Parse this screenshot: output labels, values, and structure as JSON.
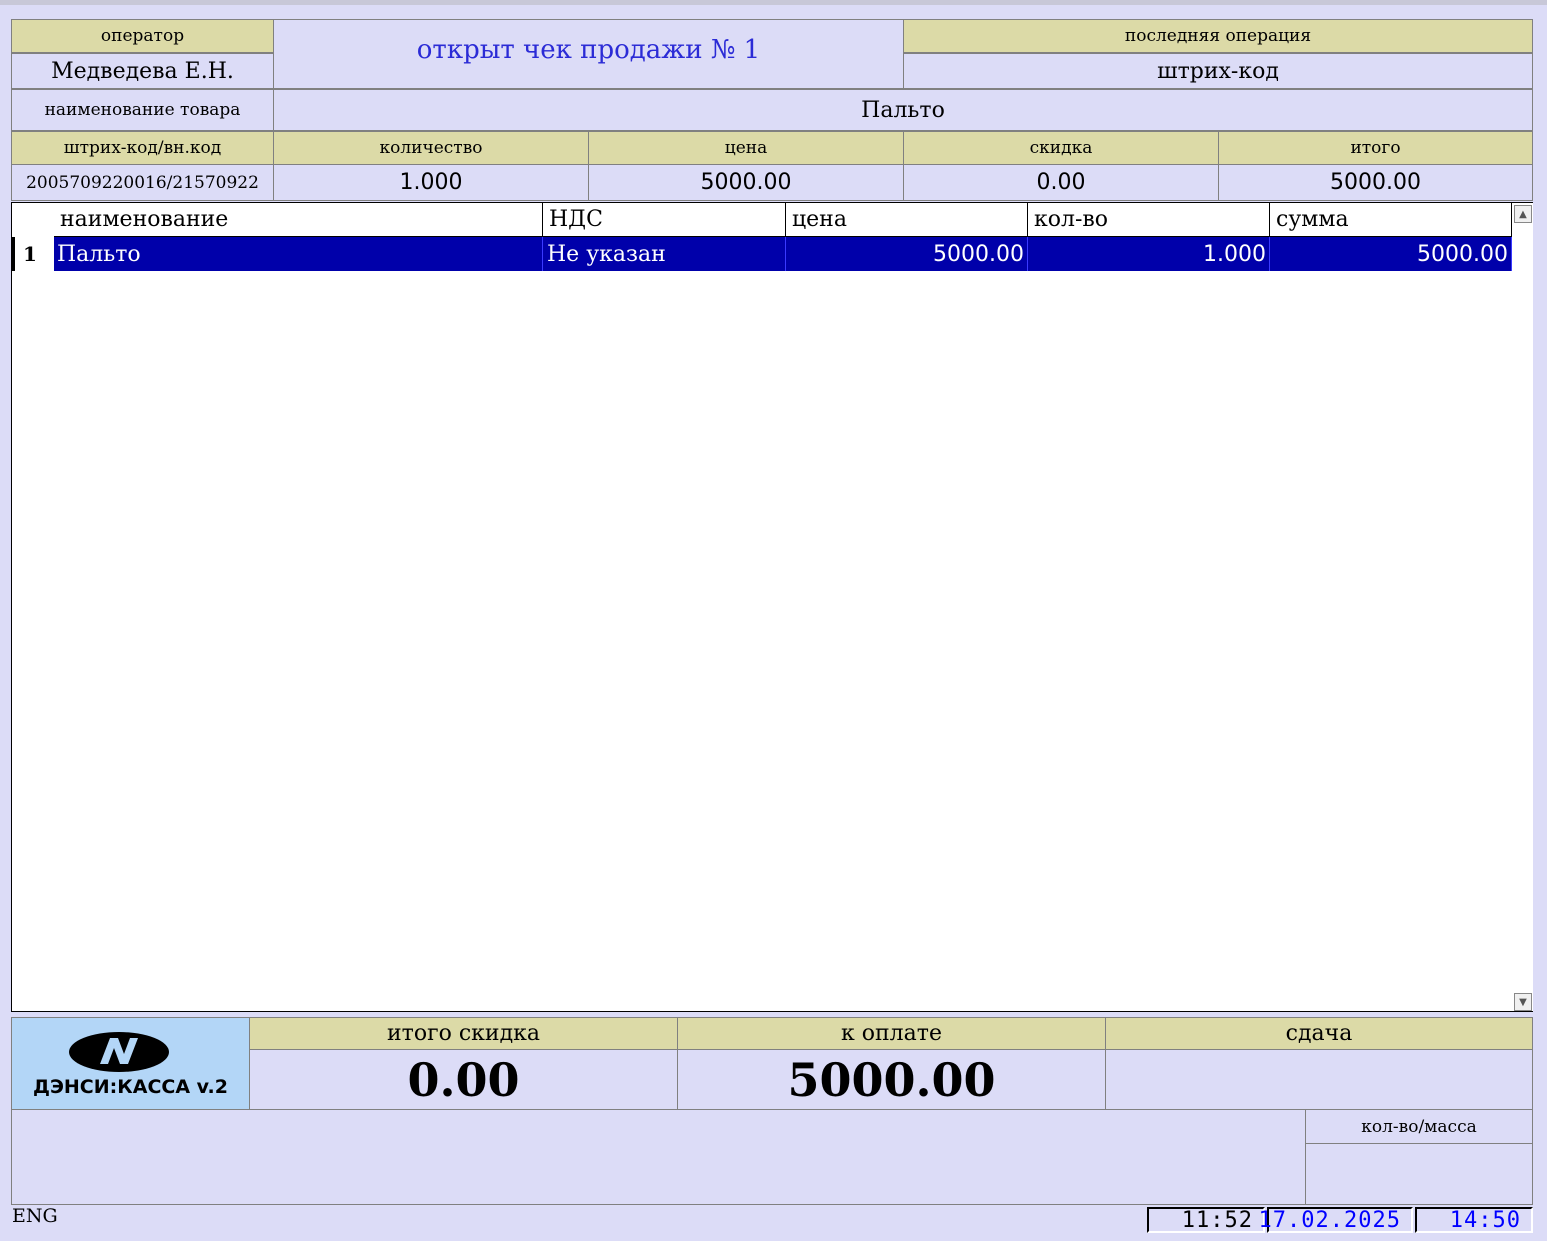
{
  "header": {
    "operator_label": "оператор",
    "operator_value": "Медведева Е.Н.",
    "status_title": "открыт чек продажи № 1",
    "last_operation_label": "последняя операция",
    "last_operation_value": "штрих-код",
    "product_name_label": "наименование товара",
    "product_name_value": "Пальто",
    "barcode_label": "штрих-код/вн.код",
    "barcode_value": "2005709220016/21570922",
    "quantity_label": "количество",
    "quantity_value": "1.000",
    "price_label": "цена",
    "price_value": "5000.00",
    "discount_label": "скидка",
    "discount_value": "0.00",
    "total_label": "итого",
    "total_value": "5000.00"
  },
  "items_table": {
    "columns": [
      "наименование",
      "НДС",
      "цена",
      "кол-во",
      "сумма"
    ],
    "rows": [
      {
        "num": "1",
        "name": "Пальто",
        "vat": "Не указан",
        "price": "5000.00",
        "qty": "1.000",
        "sum": "5000.00"
      }
    ]
  },
  "footer": {
    "logo_text": "ДЭНСИ:КАССА v.2",
    "total_discount_label": "итого скидка",
    "total_discount_value": "0.00",
    "to_pay_label": "к оплате",
    "to_pay_value": "5000.00",
    "change_label": "сдача",
    "change_value": "",
    "qty_mass_label": "кол-во/масса",
    "qty_mass_value": "",
    "message": ""
  },
  "statusbar": {
    "language": "ENG",
    "time_1": "11:52",
    "date": "17.02.2025",
    "time_2": "14:50"
  },
  "colors": {
    "background": "#dcdcf7",
    "header_label_bg": "#dcdaa7",
    "title_text": "#2b2bd6",
    "selected_row": "#0000aa",
    "logo_bg": "#b3d6f7",
    "clock_text": "#0000ff"
  }
}
